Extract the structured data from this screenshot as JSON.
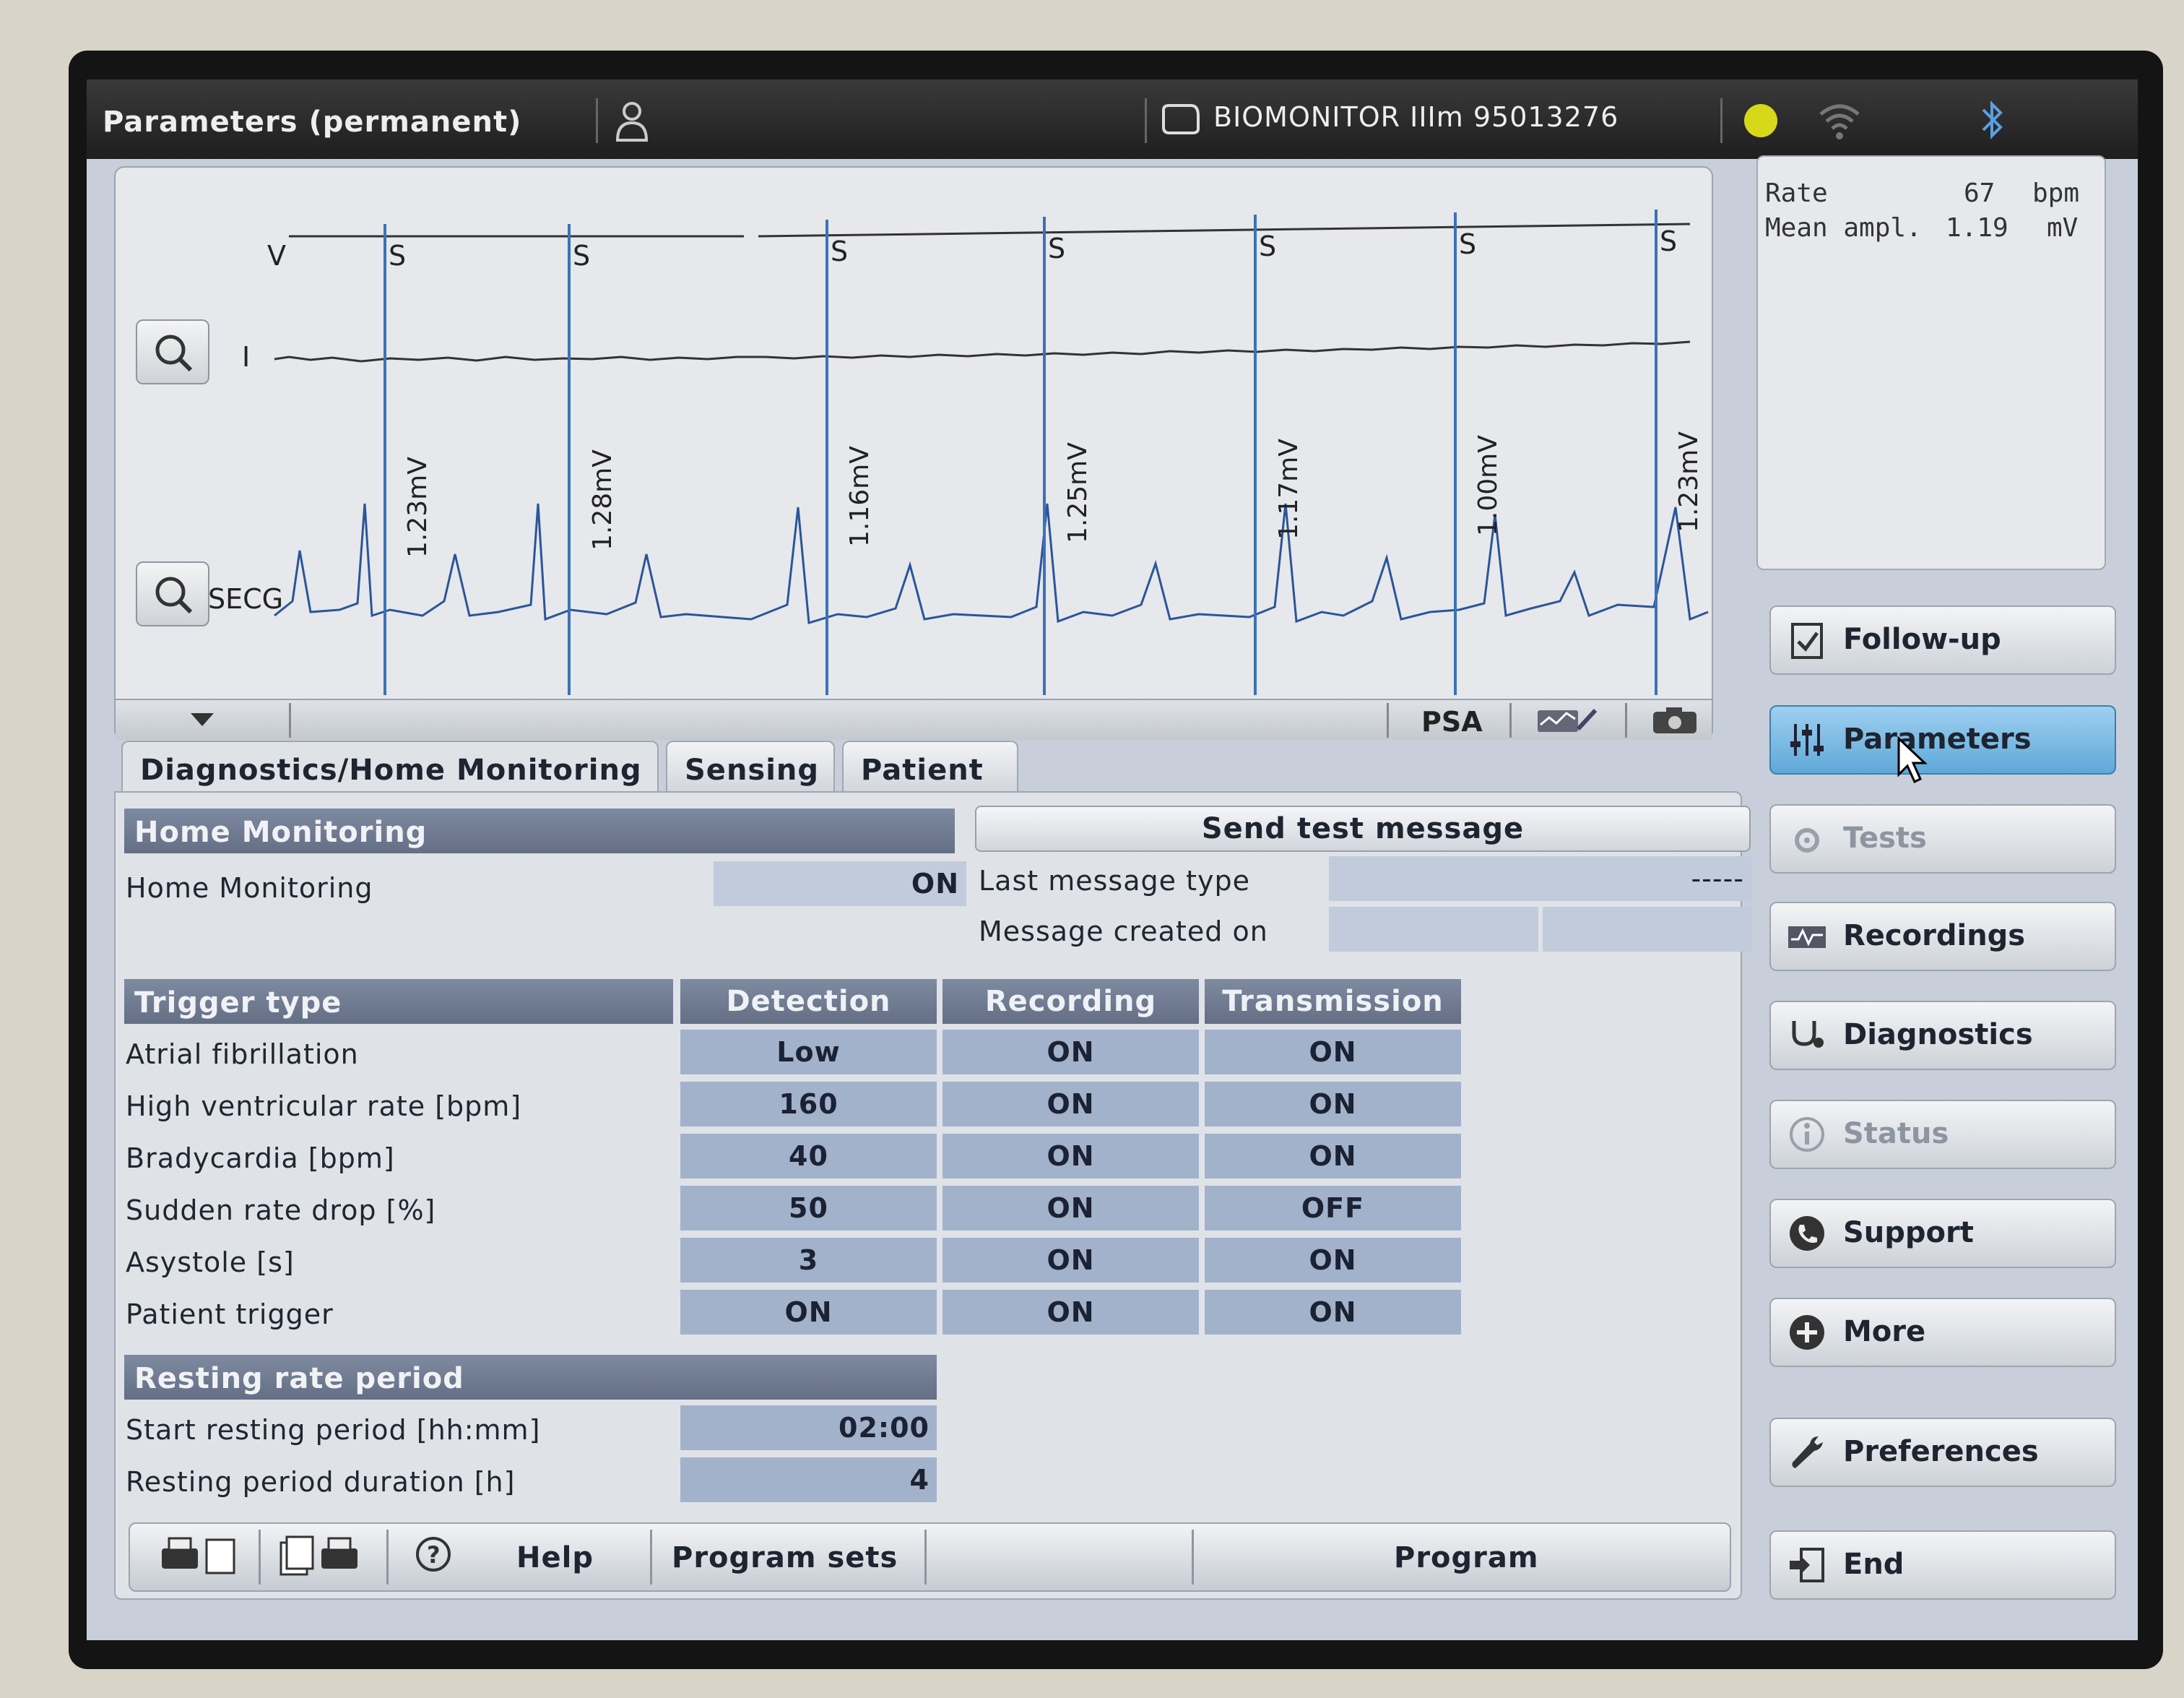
{
  "header": {
    "title": "Parameters (permanent)",
    "device": "BIOMONITOR IIIm 95013276",
    "status_color": "#d8d81a"
  },
  "ecg": {
    "marker_v": "V",
    "marker_s": [
      "S",
      "S",
      "S",
      "S",
      "S",
      "S",
      "S"
    ],
    "channel_1": "I",
    "channel_2": "SECG",
    "amplitudes": [
      "1.23mV",
      "1.28mV",
      "1.16mV",
      "1.25mV",
      "1.17mV",
      "1.00mV",
      "1.23mV"
    ],
    "psa_label": "PSA"
  },
  "stats": {
    "rate_label": "Rate",
    "rate_value": "67",
    "rate_unit": "bpm",
    "ampl_label": "Mean ampl.",
    "ampl_value": "1.19",
    "ampl_unit": "mV"
  },
  "nav": {
    "followup": "Follow-up",
    "parameters": "Parameters",
    "tests": "Tests",
    "recordings": "Recordings",
    "diagnostics": "Diagnostics",
    "status": "Status",
    "support": "Support",
    "more": "More",
    "preferences": "Preferences",
    "end": "End"
  },
  "tabs": {
    "diag": "Diagnostics/Home Monitoring",
    "sensing": "Sensing",
    "patient": "Patient"
  },
  "home": {
    "section": "Home Monitoring",
    "label": "Home Monitoring",
    "value": "ON",
    "send_button": "Send test message",
    "last_msg_label": "Last message type",
    "last_msg_value": "-----",
    "created_label": "Message created on"
  },
  "trigger": {
    "section": "Trigger type",
    "col_detection": "Detection",
    "col_recording": "Recording",
    "col_transmission": "Transmission",
    "rows": [
      {
        "label": "Atrial fibrillation",
        "detection": "Low",
        "recording": "ON",
        "transmission": "ON"
      },
      {
        "label": "High ventricular rate [bpm]",
        "detection": "160",
        "recording": "ON",
        "transmission": "ON"
      },
      {
        "label": "Bradycardia [bpm]",
        "detection": "40",
        "recording": "ON",
        "transmission": "ON"
      },
      {
        "label": "Sudden rate drop [%]",
        "detection": "50",
        "recording": "ON",
        "transmission": "OFF"
      },
      {
        "label": "Asystole [s]",
        "detection": "3",
        "recording": "ON",
        "transmission": "ON"
      },
      {
        "label": "Patient trigger",
        "detection": "ON",
        "recording": "ON",
        "transmission": "ON"
      }
    ]
  },
  "resting": {
    "section": "Resting rate period",
    "start_label": "Start resting period [hh:mm]",
    "start_value": "02:00",
    "duration_label": "Resting period duration [h]",
    "duration_value": "4"
  },
  "toolbar": {
    "help": "Help",
    "program_sets": "Program sets",
    "program": "Program"
  }
}
